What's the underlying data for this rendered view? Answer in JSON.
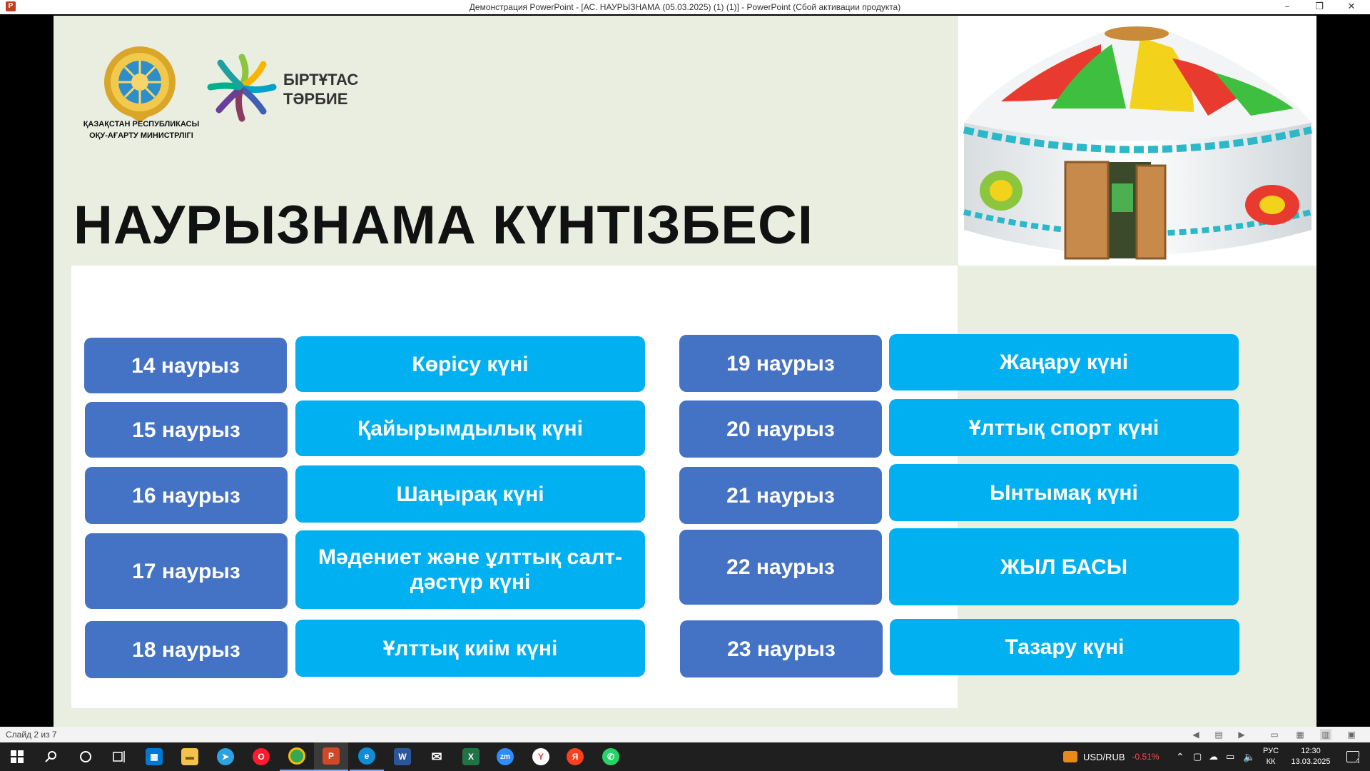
{
  "window": {
    "app_icon": "P",
    "title": "Демонстрация PowerPoint - [АС. НАУРЫЗНАМА (05.03.2025) (1) (1)] - PowerPoint (Сбой активации продукта)",
    "minimize_icon": "minimize-icon",
    "restore_icon": "restore-icon",
    "close_icon": "close-icon"
  },
  "slide": {
    "ministry_line1": "ҚАЗАҚСТАН РЕСПУБЛИКАСЫ",
    "ministry_line2": "ОҚУ-АҒАРТУ МИНИСТРЛІГІ",
    "brand_line1": "БІРТҰТАС",
    "brand_line2": "ТӘРБИЕ",
    "title": "НАУРЫЗНАМА КҮНТІЗБЕСІ",
    "schedule": [
      {
        "date": "14 наурыз",
        "event": "Көрісу күні"
      },
      {
        "date": "15 наурыз",
        "event": "Қайырымдылық күні"
      },
      {
        "date": "16 наурыз",
        "event": "Шаңырақ күні"
      },
      {
        "date": "17 наурыз",
        "event": "Мәдениет және ұлттық салт-дәстүр  күні"
      },
      {
        "date": "18 наурыз",
        "event": "Ұлттық киім күні"
      },
      {
        "date": "19 наурыз",
        "event": "Жаңару күні"
      },
      {
        "date": "20 наурыз",
        "event": "Ұлттық спорт күні"
      },
      {
        "date": "21 наурыз",
        "event": "Ынтымақ күні"
      },
      {
        "date": "22 наурыз",
        "event": "ЖЫЛ БАСЫ"
      },
      {
        "date": "23 наурыз",
        "event": "Тазару күні"
      }
    ],
    "colors": {
      "date_pill": "#4472c4",
      "event_pill": "#00b0f0",
      "background": "#eaeee0"
    }
  },
  "statusbar": {
    "slide_indicator": "Слайд 2 из 7"
  },
  "taskbar": {
    "currency_pair": "USD/RUB",
    "currency_change": "-0.51%",
    "language_line1": "РУС",
    "language_line2": "КК",
    "time": "12:30",
    "date": "13.03.2025",
    "notification_count": "4",
    "apps": [
      "windows-start-icon",
      "search-icon",
      "cortana-icon",
      "task-view-icon",
      "store-icon",
      "file-explorer-icon",
      "telegram-icon",
      "opera-icon",
      "chrome-icon",
      "powerpoint-icon",
      "edge-icon",
      "word-icon",
      "mail-icon",
      "excel-icon",
      "zoom-icon",
      "yandex-browser-icon",
      "yandex-icon",
      "whatsapp-icon"
    ]
  }
}
